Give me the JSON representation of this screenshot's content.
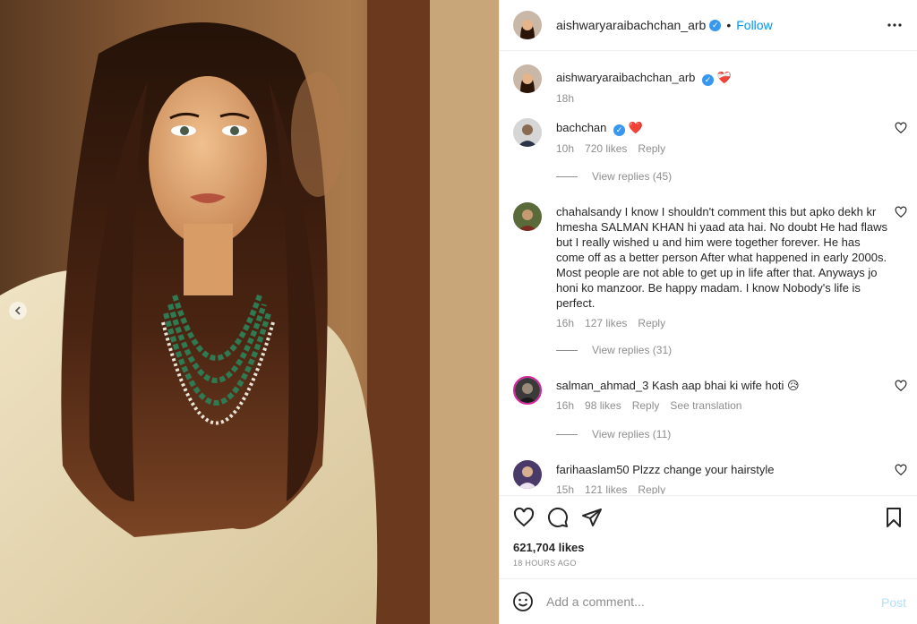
{
  "post_header": {
    "username": "aishwaryaraibachchan_arb",
    "verified_mark": "✓",
    "separator": "•",
    "follow_label": "Follow",
    "more_icon": "more-horizontal-icon"
  },
  "caption": {
    "username": "aishwaryaraibachchan_arb",
    "text": "❤️‍🩹",
    "time": "18h"
  },
  "comments": [
    {
      "username": "bachchan",
      "text": "❤️",
      "time": "10h",
      "likes": "720 likes",
      "reply_label": "Reply",
      "view_replies": "View replies (45)"
    },
    {
      "username": "chahalsandy",
      "text": "I know I shouldn't comment this but apko dekh kr hmesha SALMAN KHAN hi yaad ata hai. No doubt He had flaws but I really wished u and him were together forever. He has come off as a better person After what happened in early 2000s. Most people are not able to get up in life after that. Anyways jo honi ko manzoor. Be happy madam. I know Nobody's life is perfect.",
      "time": "16h",
      "likes": "127 likes",
      "reply_label": "Reply",
      "view_replies": "View replies (31)"
    },
    {
      "username": "salman_ahmad_3",
      "text": "Kash aap bhai ki wife hoti 😥",
      "time": "16h",
      "likes": "98 likes",
      "reply_label": "Reply",
      "translation_label": "See translation",
      "view_replies": "View replies (11)"
    },
    {
      "username": "farihaaslam50",
      "text": "Plzzz change your hairstyle",
      "time": "15h",
      "likes": "121 likes",
      "reply_label": "Reply"
    }
  ],
  "actions": {
    "like_icon": "heart-icon",
    "comment_icon": "comment-icon",
    "share_icon": "share-icon",
    "save_icon": "bookmark-icon"
  },
  "likes_count": "621,704 likes",
  "posted_ago": "18 HOURS AGO",
  "add_comment": {
    "emoji_icon": "emoji-icon",
    "placeholder": "Add a comment...",
    "post_label": "Post"
  },
  "colors": {
    "accent": "#0095f6",
    "verified": "#3897f0",
    "muted": "#8e8e8e",
    "like_red": "#ed4956",
    "post_disabled": "#b2dffc"
  }
}
